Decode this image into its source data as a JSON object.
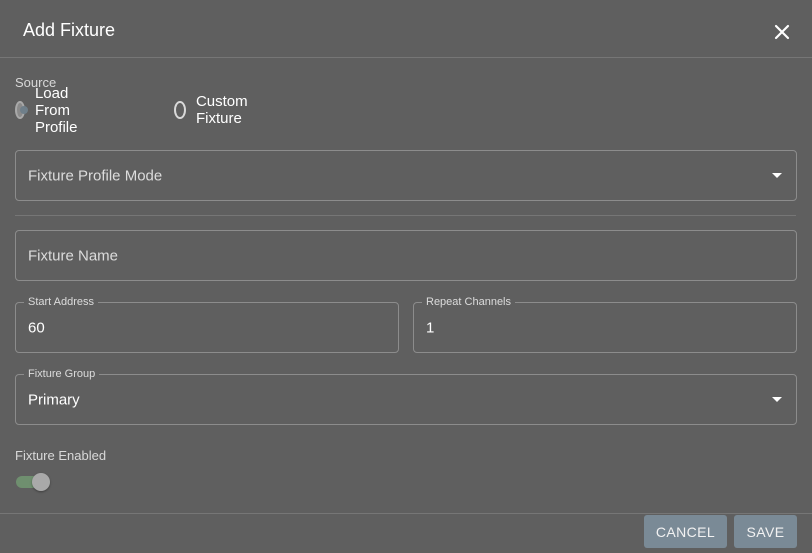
{
  "dialog": {
    "title": "Add Fixture",
    "close_icon": "close-icon"
  },
  "source": {
    "label": "Source",
    "options": [
      {
        "label": "Load From Profile",
        "checked": true
      },
      {
        "label": "Custom Fixture",
        "checked": false
      }
    ]
  },
  "profile_mode": {
    "placeholder": "Fixture Profile Mode"
  },
  "fixture_name": {
    "placeholder": "Fixture Name"
  },
  "start_address": {
    "label": "Start Address",
    "value": "60"
  },
  "repeat_channels": {
    "label": "Repeat Channels",
    "value": "1"
  },
  "fixture_group": {
    "label": "Fixture Group",
    "value": "Primary"
  },
  "fixture_enabled": {
    "label": "Fixture Enabled",
    "on": true
  },
  "footer": {
    "cancel_label": "CANCEL",
    "save_label": "SAVE"
  }
}
